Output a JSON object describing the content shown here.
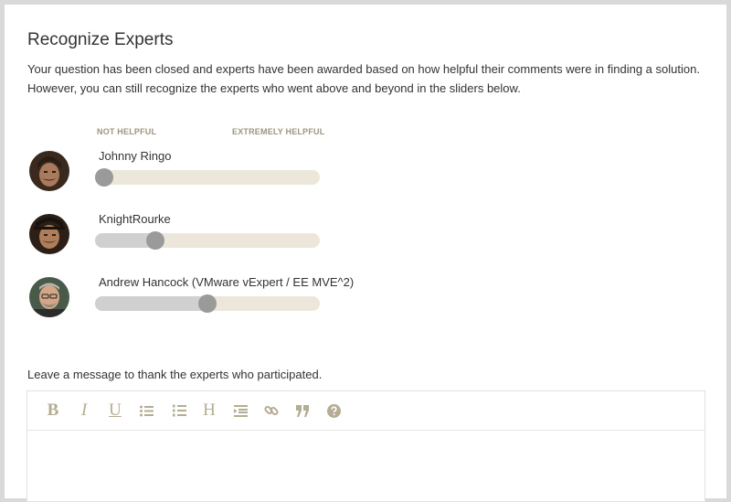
{
  "dialog": {
    "title": "Recognize Experts",
    "description": "Your question has been closed and experts have been awarded based on how helpful their comments were in finding a solution. However, you can still recognize the experts who went above and beyond in the sliders below."
  },
  "scale": {
    "min_label": "NOT HELPFUL",
    "max_label": "EXTREMELY HELPFUL"
  },
  "experts": [
    {
      "name": "Johnny Ringo",
      "helpfulness_percent": 4
    },
    {
      "name": "KnightRourke",
      "helpfulness_percent": 27
    },
    {
      "name": "Andrew Hancock (VMware vExpert / EE MVE^2)",
      "helpfulness_percent": 50
    }
  ],
  "message": {
    "label": "Leave a message to thank the experts who participated."
  },
  "editor_toolbar": {
    "bold": "B",
    "italic": "I",
    "underline": "U",
    "heading": "H"
  },
  "colors": {
    "track": "#ece7da",
    "fill": "#d0d0d0",
    "thumb": "#9a9a9a",
    "toolbar_icon": "#b5ac94",
    "scale_label": "#9d9580"
  }
}
